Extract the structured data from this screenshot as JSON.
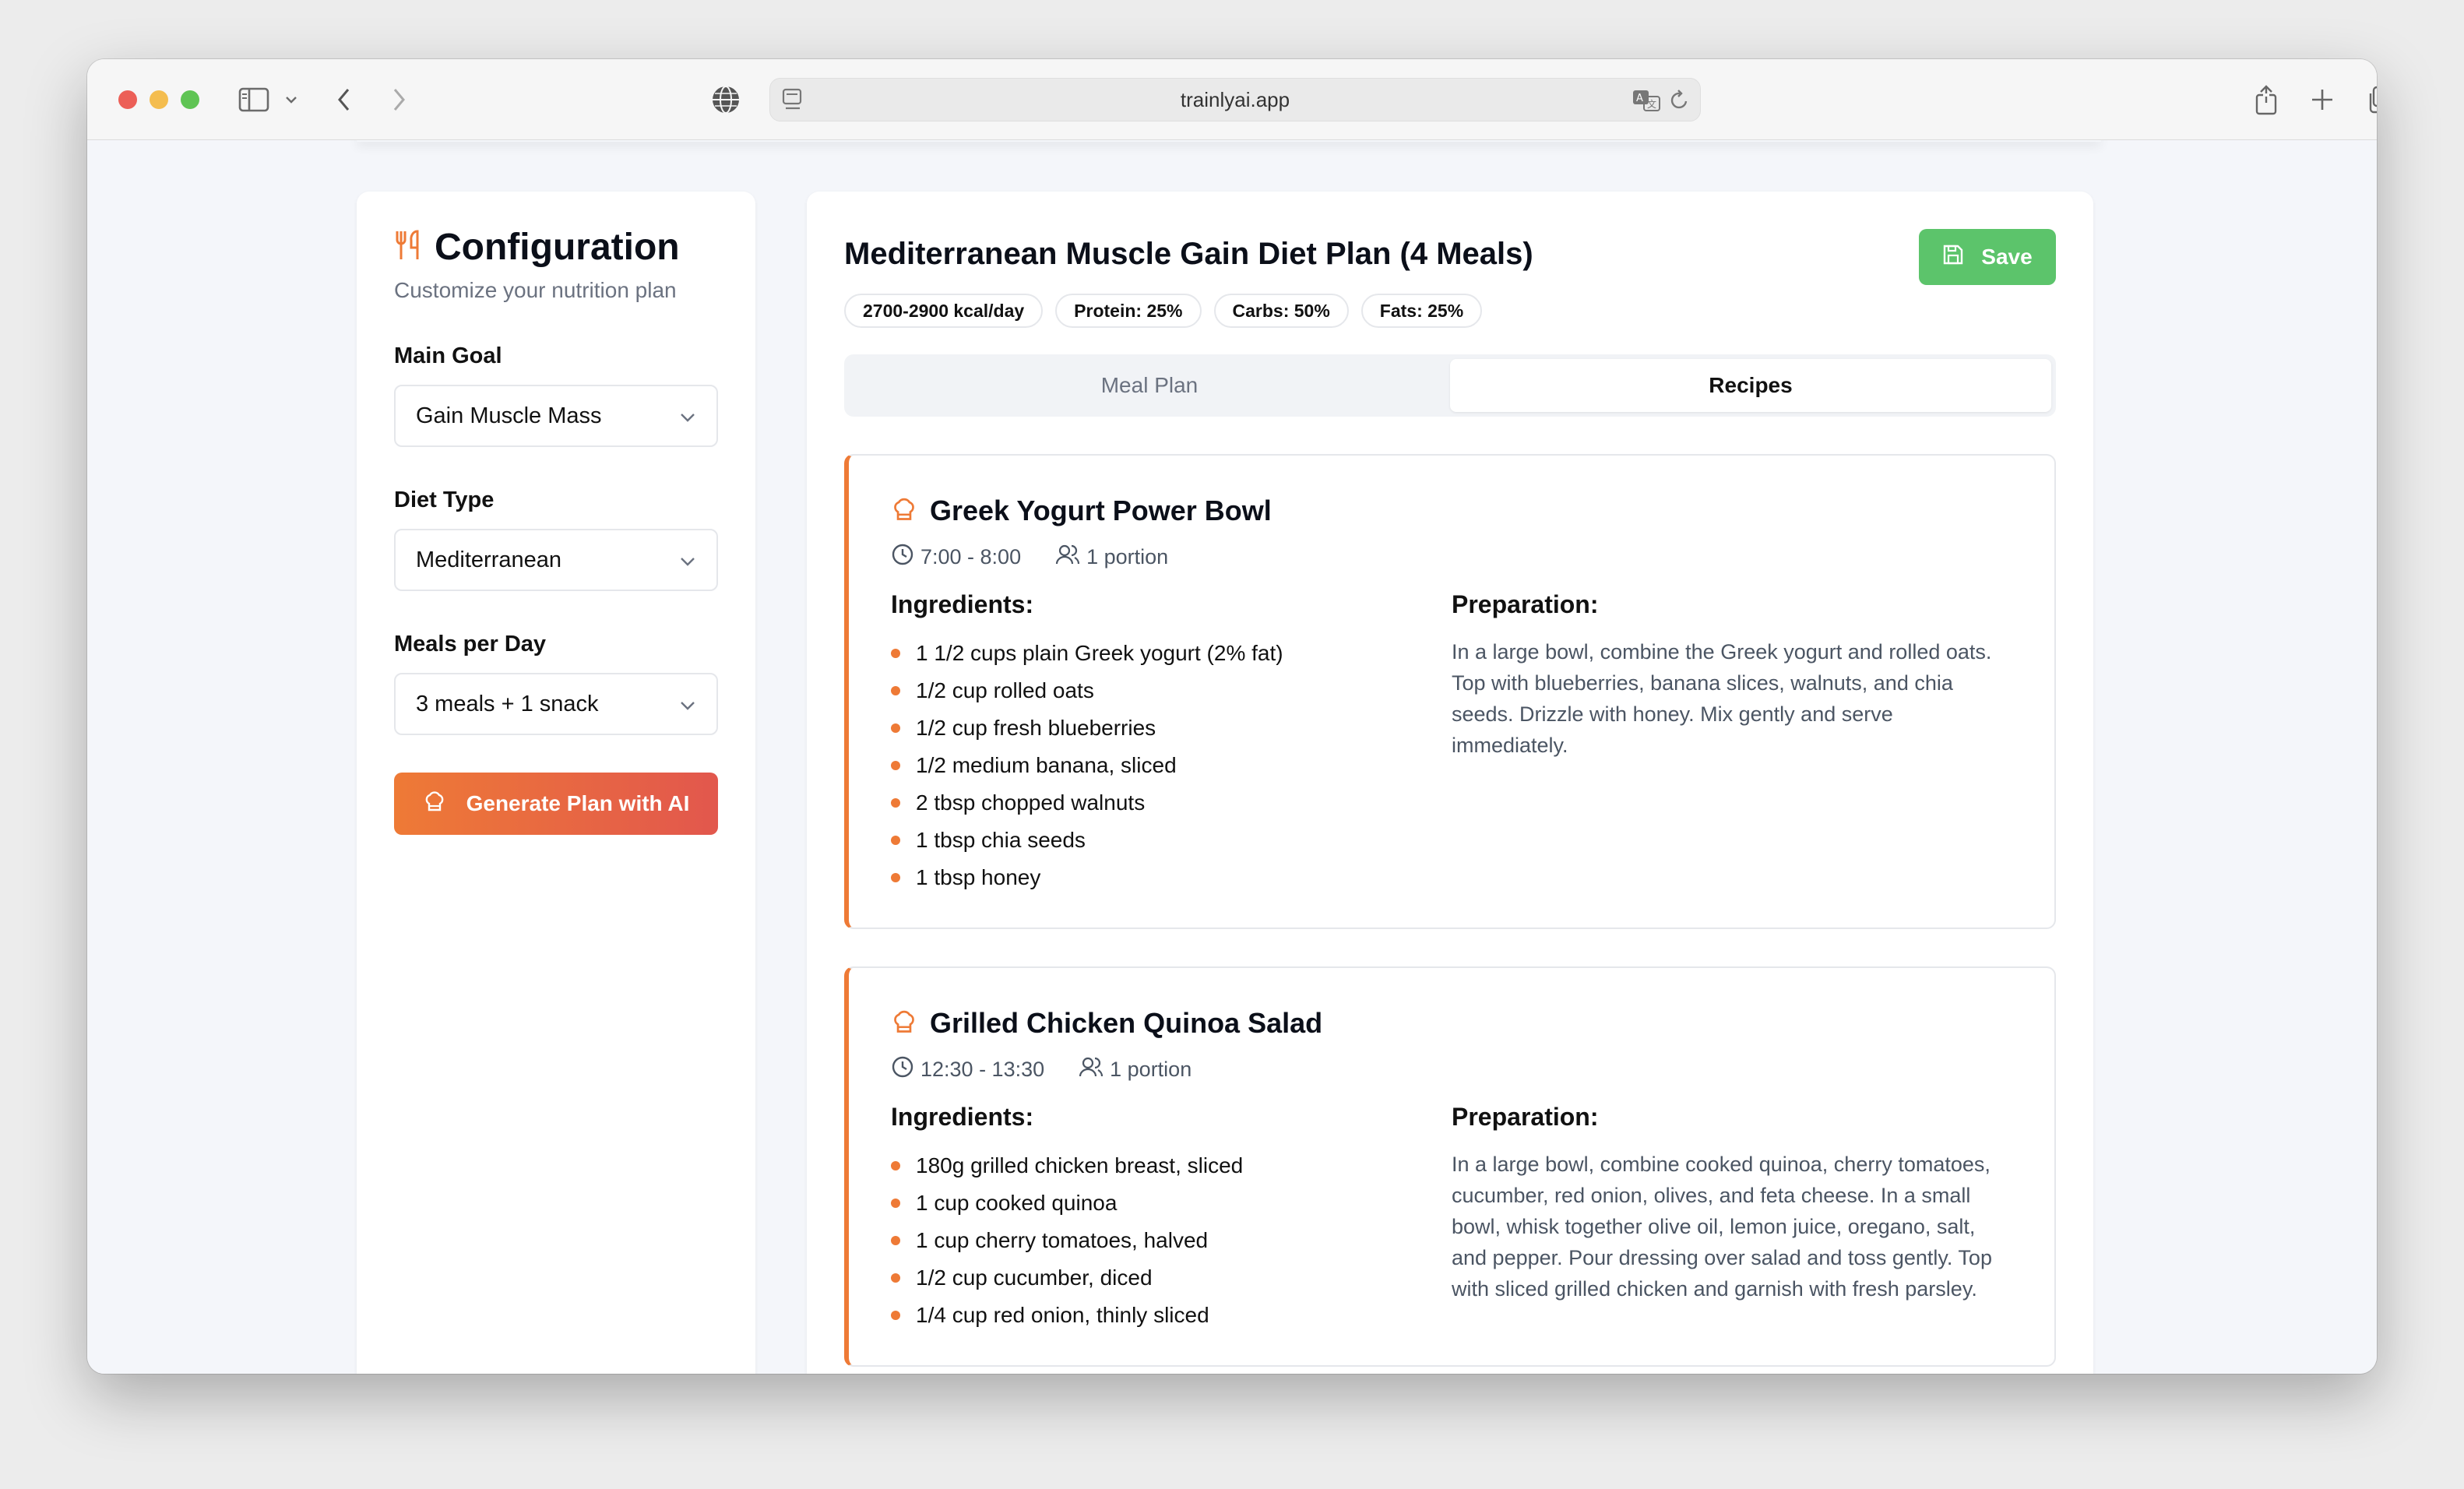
{
  "browser": {
    "url": "trainlyai.app"
  },
  "config": {
    "title": "Configuration",
    "subtitle": "Customize your nutrition plan",
    "fields": [
      {
        "label": "Main Goal",
        "value": "Gain Muscle Mass"
      },
      {
        "label": "Diet Type",
        "value": "Mediterranean"
      },
      {
        "label": "Meals per Day",
        "value": "3 meals + 1 snack"
      }
    ],
    "generate_label": "Generate Plan with AI"
  },
  "plan": {
    "title": "Mediterranean Muscle Gain Diet Plan (4 Meals)",
    "save_label": "Save",
    "badges": [
      "2700-2900 kcal/day",
      "Protein: 25%",
      "Carbs: 50%",
      "Fats: 25%"
    ],
    "tabs": [
      {
        "label": "Meal Plan",
        "active": false
      },
      {
        "label": "Recipes",
        "active": true
      }
    ],
    "ingredients_heading": "Ingredients:",
    "preparation_heading": "Preparation:",
    "recipes": [
      {
        "title": "Greek Yogurt Power Bowl",
        "time": "7:00 - 8:00",
        "portion": "1 portion",
        "ingredients": [
          "1 1/2 cups plain Greek yogurt (2% fat)",
          "1/2 cup rolled oats",
          "1/2 cup fresh blueberries",
          "1/2 medium banana, sliced",
          "2 tbsp chopped walnuts",
          "1 tbsp chia seeds",
          "1 tbsp honey"
        ],
        "preparation": "In a large bowl, combine the Greek yogurt and rolled oats. Top with blueberries, banana slices, walnuts, and chia seeds. Drizzle with honey. Mix gently and serve immediately."
      },
      {
        "title": "Grilled Chicken Quinoa Salad",
        "time": "12:30 - 13:30",
        "portion": "1 portion",
        "ingredients": [
          "180g grilled chicken breast, sliced",
          "1 cup cooked quinoa",
          "1 cup cherry tomatoes, halved",
          "1/2 cup cucumber, diced",
          "1/4 cup red onion, thinly sliced"
        ],
        "preparation": "In a large bowl, combine cooked quinoa, cherry tomatoes, cucumber, red onion, olives, and feta cheese. In a small bowl, whisk together olive oil, lemon juice, oregano, salt, and pepper. Pour dressing over salad and toss gently. Top with sliced grilled chicken and garnish with fresh parsley."
      }
    ]
  },
  "colors": {
    "accent_orange": "#ee7a36",
    "save_green": "#5cc46b",
    "gradient_end": "#e2574d"
  }
}
